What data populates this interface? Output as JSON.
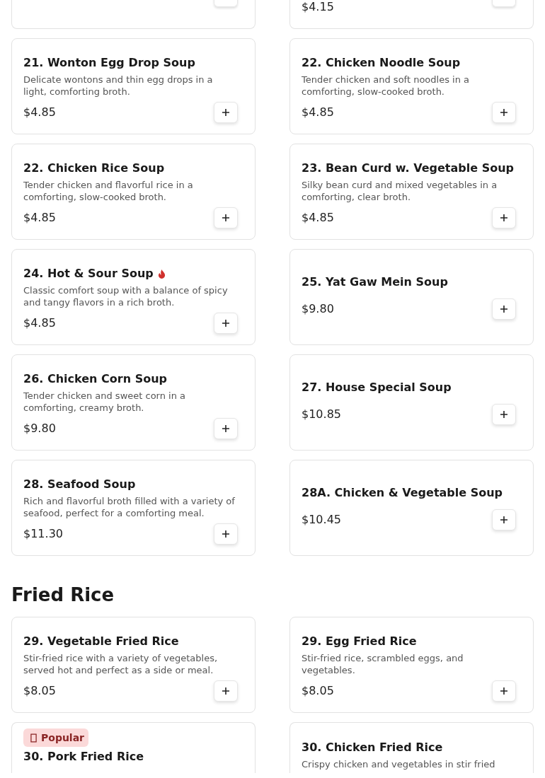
{
  "cut_row": {
    "right_price": "$4.15"
  },
  "sections": [
    {
      "items": [
        {
          "name": "21. Wonton Egg Drop Soup",
          "description": "Delicate wontons and thin egg drops in a light, comforting broth.",
          "price": "$4.85",
          "spicy": false
        },
        {
          "name": "22. Chicken Noodle Soup",
          "description": "Tender chicken and soft noodles in a comforting, slow-cooked broth.",
          "price": "$4.85",
          "spicy": false
        },
        {
          "name": "22. Chicken Rice Soup",
          "description": "Tender chicken and flavorful rice in a comforting, slow-cooked broth.",
          "price": "$4.85",
          "spicy": false
        },
        {
          "name": "23. Bean Curd w. Vegetable Soup",
          "description": "Silky bean curd and mixed vegetables in a comforting, clear broth.",
          "price": "$4.85",
          "spicy": false
        },
        {
          "name": "24. Hot & Sour Soup",
          "description": "Classic comfort soup with a balance of spicy and tangy flavors in a rich broth.",
          "price": "$4.85",
          "spicy": true
        },
        {
          "name": "25. Yat Gaw Mein Soup",
          "price": "$9.80",
          "spicy": false
        },
        {
          "name": "26. Chicken Corn Soup",
          "description": "Tender chicken and sweet corn in a comforting, creamy broth.",
          "price": "$9.80",
          "spicy": false
        },
        {
          "name": "27. House Special Soup",
          "price": "$10.85",
          "spicy": false
        },
        {
          "name": "28. Seafood Soup",
          "description": "Rich and flavorful broth filled with a variety of seafood, perfect for a comforting meal.",
          "price": "$11.30",
          "spicy": false
        },
        {
          "name": "28A. Chicken & Vegetable Soup",
          "price": "$10.45",
          "spicy": false
        }
      ]
    },
    {
      "title": "Fried Rice",
      "items": [
        {
          "name": "29. Vegetable Fried Rice",
          "description": "Stir-fried rice with a variety of vegetables, served hot and perfect as a side or meal.",
          "price": "$8.05",
          "spicy": false
        },
        {
          "name": "29. Egg Fried Rice",
          "description": "Stir-fried rice, scrambled eggs, and vegetables.",
          "price": "$8.05",
          "spicy": false
        },
        {
          "name": "30. Pork Fried Rice",
          "badge": "Popular"
        },
        {
          "name": "30. Chicken Fried Rice",
          "description": "Crispy chicken and vegetables in stir fried"
        }
      ]
    }
  ]
}
